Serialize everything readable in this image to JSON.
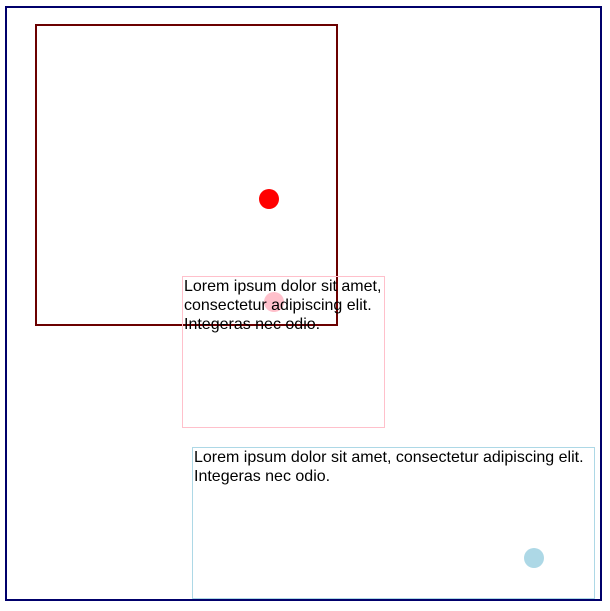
{
  "colors": {
    "outer_frame": "#00006b",
    "square_border": "#6b0000",
    "red_dot": "#ff0000",
    "pink": "#ffc0cb",
    "light_blue": "#add8e6"
  },
  "boxes": {
    "pink": {
      "text": "Lorem ipsum dolor sit amet, consectetur adipiscing elit. Integeras nec odio."
    },
    "light_blue": {
      "text": "Lorem ipsum dolor sit amet, consectetur adipiscing elit. Integeras nec odio."
    }
  }
}
